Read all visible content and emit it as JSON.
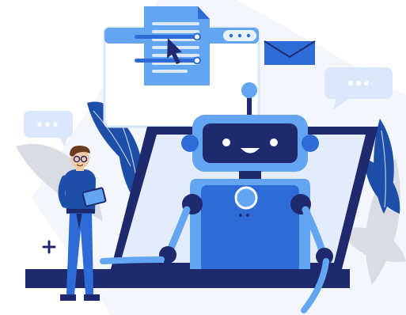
{
  "illustration": {
    "subject": "robot-assistant-with-user",
    "icons": [
      "document-icon",
      "cursor-icon",
      "envelope-icon",
      "chat-bubble-icon",
      "plus-icon",
      "tablet-icon"
    ],
    "colors": {
      "navy": "#1f2a6e",
      "blue": "#2f6bd6",
      "light_blue": "#63a5f0",
      "pale_blue": "#dbe8fb",
      "screen": "#e4ecfb",
      "leaf_dark": "#1d4ea8",
      "gray_leaf": "#d9dde3",
      "skin": "#f3c9a8",
      "hair": "#6b3b1f"
    }
  }
}
